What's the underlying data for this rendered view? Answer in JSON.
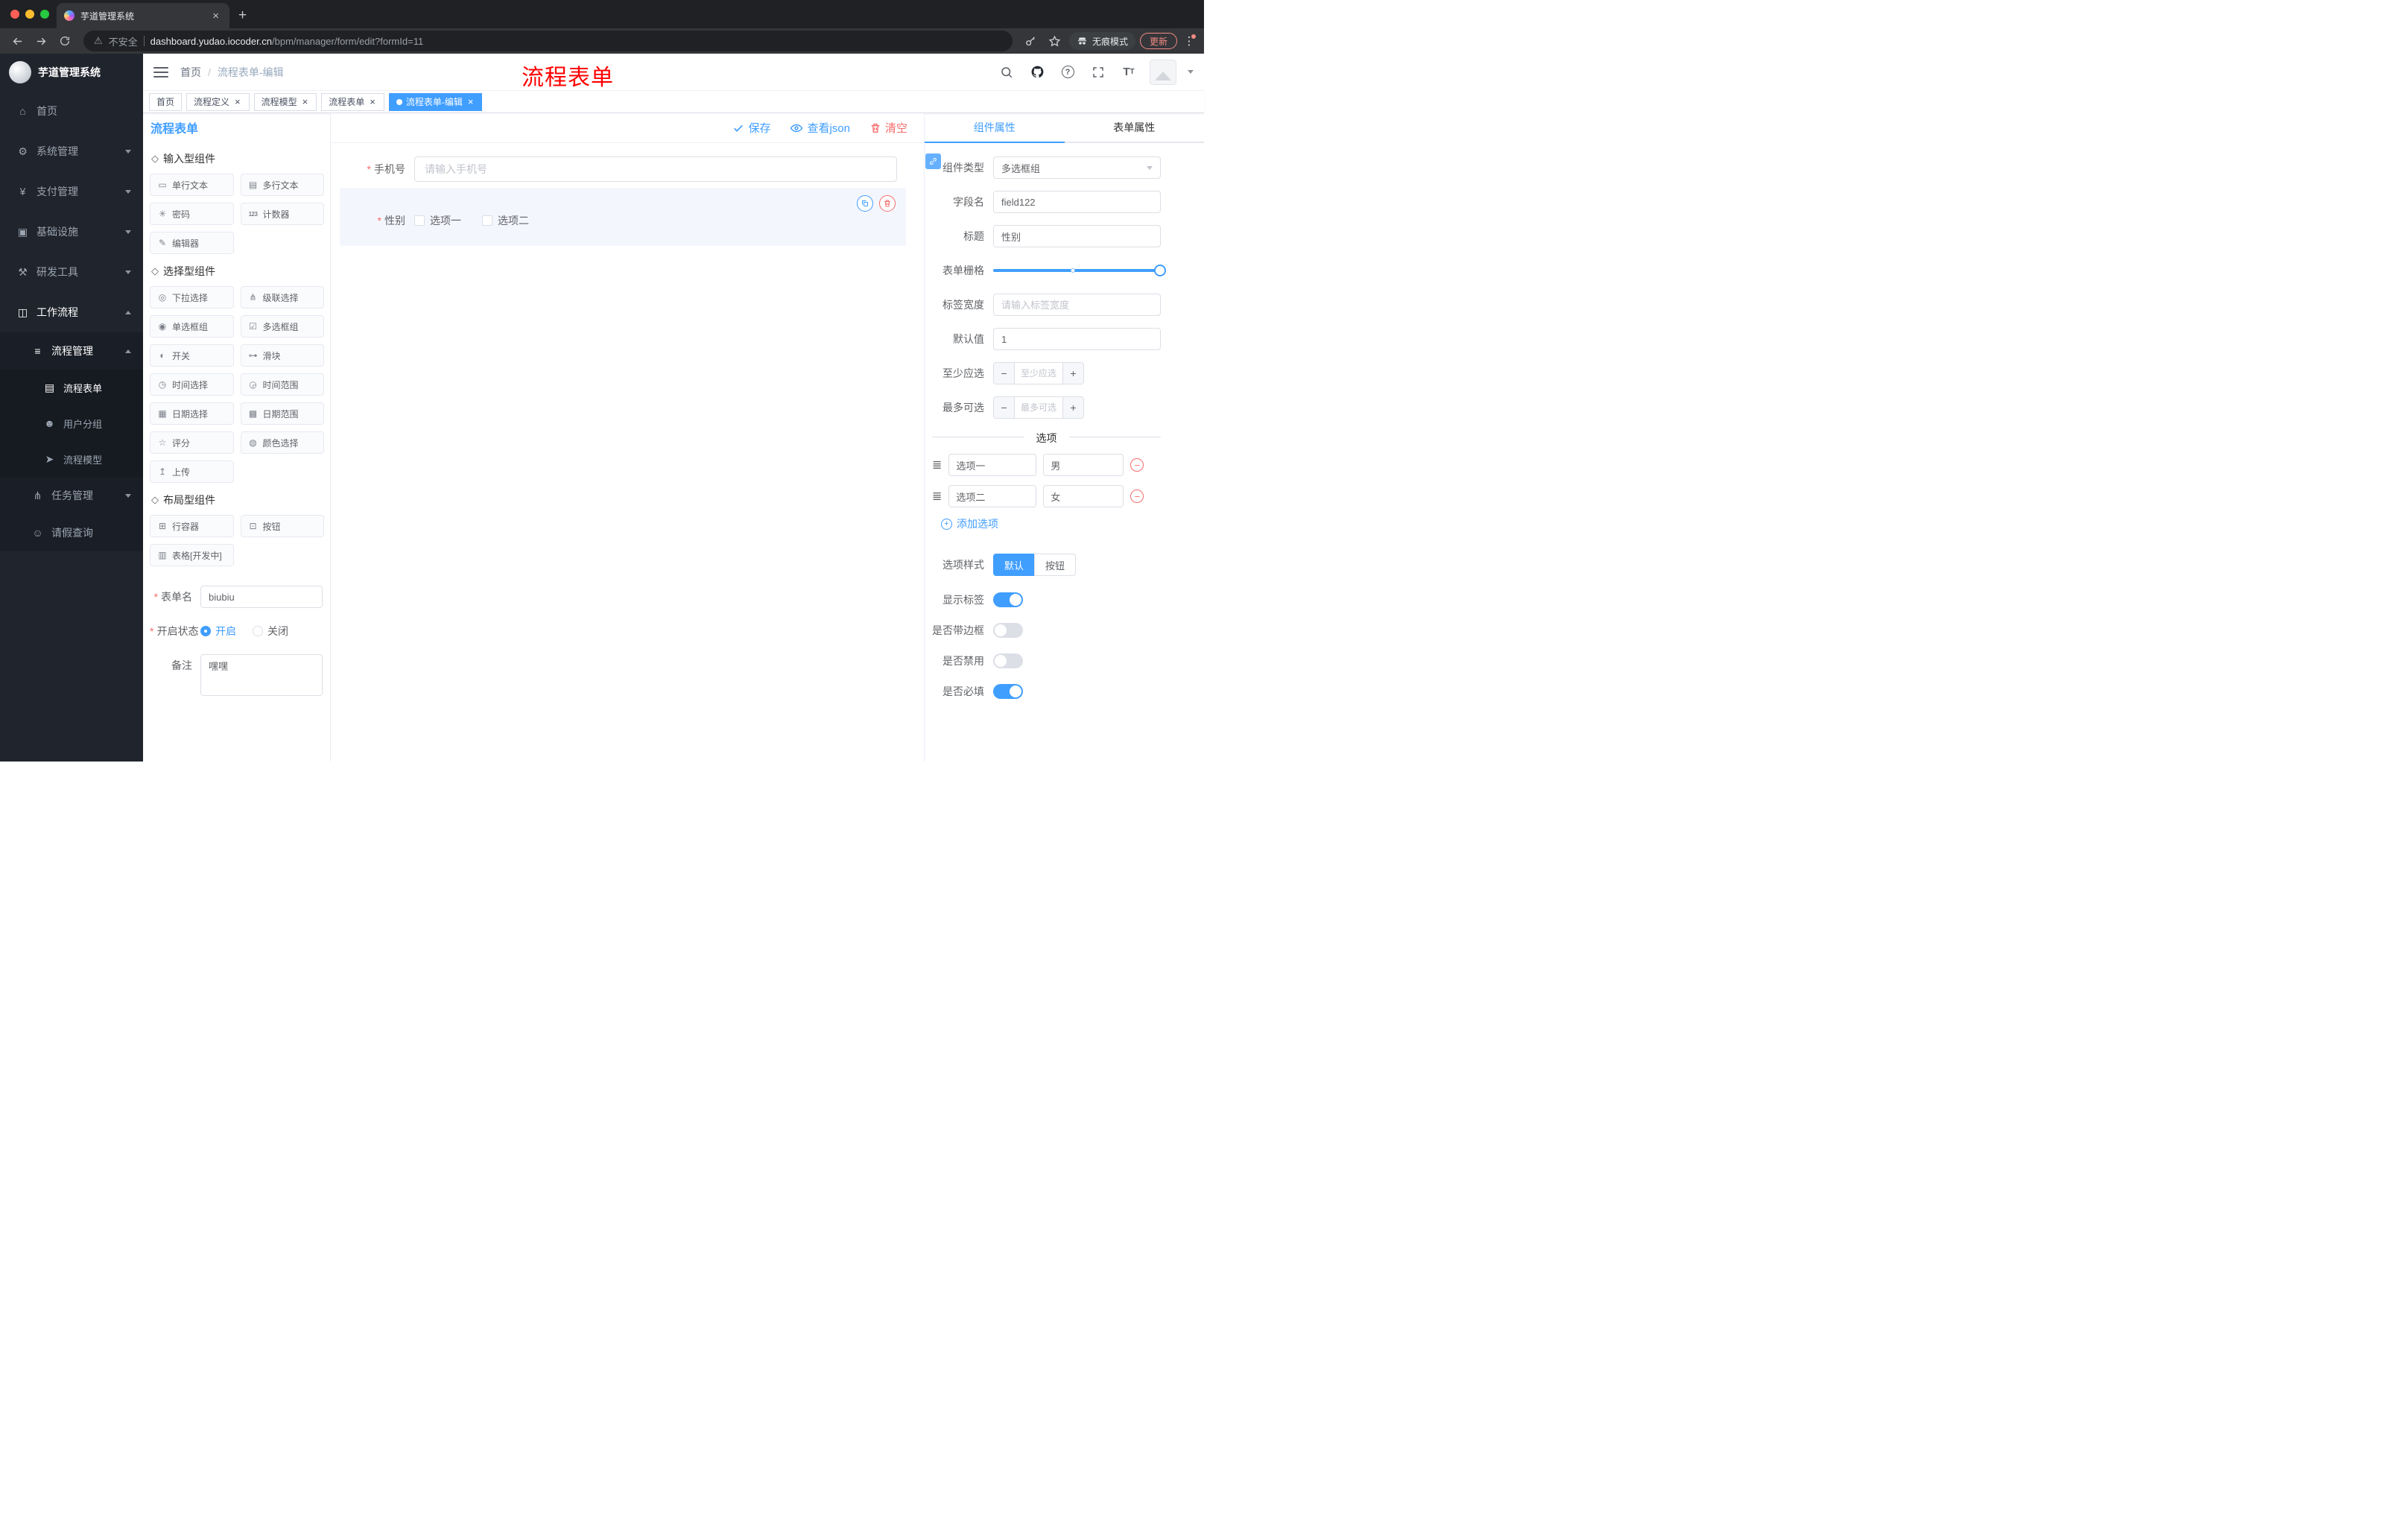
{
  "chrome": {
    "tab_title": "芋道管理系统",
    "security_label": "不安全",
    "url_host": "dashboard.yudao.iocoder.cn",
    "url_path": "/bpm/manager/form/edit?formId=11",
    "incognito_label": "无痕模式",
    "update_label": "更新"
  },
  "sidebar": {
    "logo_title": "芋道管理系统",
    "menu": [
      {
        "key": "home",
        "label": "首页",
        "icon": "dashboard-icon",
        "level": 1
      },
      {
        "key": "system",
        "label": "系统管理",
        "icon": "gear-icon",
        "level": 1,
        "chevron": "down"
      },
      {
        "key": "payment",
        "label": "支付管理",
        "icon": "payment-icon",
        "level": 1,
        "chevron": "down"
      },
      {
        "key": "infrastructure",
        "label": "基础设施",
        "icon": "infrastructure-icon",
        "level": 1,
        "chevron": "down"
      },
      {
        "key": "devtools",
        "label": "研发工具",
        "icon": "tools-icon",
        "level": 1,
        "chevron": "down"
      },
      {
        "key": "workflow",
        "label": "工作流程",
        "icon": "workflow-icon",
        "level": 1,
        "chevron": "up",
        "open": true
      },
      {
        "key": "process-management",
        "label": "流程管理",
        "icon": "process-icon",
        "level": 2,
        "chevron": "up",
        "open": true
      },
      {
        "key": "process-form",
        "label": "流程表单",
        "icon": "form-icon",
        "level": 3,
        "active": true
      },
      {
        "key": "user-group",
        "label": "用户分组",
        "icon": "user-group-icon",
        "level": 3
      },
      {
        "key": "process-model",
        "label": "流程模型",
        "icon": "model-icon",
        "level": 3
      },
      {
        "key": "task-management",
        "label": "任务管理",
        "icon": "task-icon",
        "level": 2,
        "chevron": "down"
      },
      {
        "key": "leave-query",
        "label": "请假查询",
        "icon": "leave-icon",
        "level": 2
      }
    ]
  },
  "navbar": {
    "breadcrumb_home": "首页",
    "breadcrumb_current": "流程表单-编辑",
    "watermark": "流程表单"
  },
  "tags": [
    {
      "key": "home",
      "label": "首页",
      "closable": false,
      "active": false
    },
    {
      "key": "process-definition",
      "label": "流程定义",
      "closable": true,
      "active": false
    },
    {
      "key": "process-model",
      "label": "流程模型",
      "closable": true,
      "active": false
    },
    {
      "key": "process-form",
      "label": "流程表单",
      "closable": true,
      "active": false
    },
    {
      "key": "process-form-edit",
      "label": "流程表单-编辑",
      "closable": true,
      "active": true
    }
  ],
  "palette": {
    "title": "流程表单",
    "sections": [
      {
        "title": "输入型组件",
        "items": [
          {
            "key": "input",
            "label": "单行文本",
            "icon": "input-icon"
          },
          {
            "key": "textarea",
            "label": "多行文本",
            "icon": "textarea-icon"
          },
          {
            "key": "password",
            "label": "密码",
            "icon": "lock-icon"
          },
          {
            "key": "counter",
            "label": "计数器",
            "icon": "counter-icon"
          },
          {
            "key": "editor",
            "label": "编辑器",
            "icon": "editor-icon"
          }
        ]
      },
      {
        "title": "选择型组件",
        "items": [
          {
            "key": "select",
            "label": "下拉选择",
            "icon": "select-icon"
          },
          {
            "key": "cascader",
            "label": "级联选择",
            "icon": "cascader-icon"
          },
          {
            "key": "radio-group",
            "label": "单选框组",
            "icon": "radio-icon"
          },
          {
            "key": "checkbox-group",
            "label": "多选框组",
            "icon": "checkbox-icon"
          },
          {
            "key": "switch",
            "label": "开关",
            "icon": "switch-icon"
          },
          {
            "key": "slider",
            "label": "滑块",
            "icon": "slider-icon"
          },
          {
            "key": "time-picker",
            "label": "时间选择",
            "icon": "time-icon"
          },
          {
            "key": "time-range",
            "label": "时间范围",
            "icon": "time-range-icon"
          },
          {
            "key": "date-picker",
            "label": "日期选择",
            "icon": "date-icon"
          },
          {
            "key": "date-range",
            "label": "日期范围",
            "icon": "date-range-icon"
          },
          {
            "key": "rate",
            "label": "评分",
            "icon": "rate-icon"
          },
          {
            "key": "color-picker",
            "label": "颜色选择",
            "icon": "color-icon"
          },
          {
            "key": "upload",
            "label": "上传",
            "icon": "upload-icon"
          }
        ]
      },
      {
        "title": "布局型组件",
        "items": [
          {
            "key": "row-container",
            "label": "行容器",
            "icon": "row-icon"
          },
          {
            "key": "button",
            "label": "按钮",
            "icon": "button-icon"
          },
          {
            "key": "table",
            "label": "表格[开发中]",
            "icon": "table-icon"
          }
        ]
      }
    ],
    "meta": {
      "form_name_label": "表单名",
      "form_name_value": "biubiu",
      "status_label": "开启状态",
      "status_on": "开启",
      "status_off": "关闭",
      "remark_label": "备注",
      "remark_value": "嘿嘿"
    }
  },
  "canvas": {
    "toolbar": {
      "save": "保存",
      "view_json": "查看json",
      "clear": "清空"
    },
    "phone_field": {
      "label": "手机号",
      "placeholder": "请输入手机号"
    },
    "gender_field": {
      "label": "性别",
      "option1": "选项一",
      "option2": "选项二"
    }
  },
  "props": {
    "tab_component": "组件属性",
    "tab_form": "表单属性",
    "component_type_label": "组件类型",
    "component_type_value": "多选框组",
    "field_name_label": "字段名",
    "field_name_value": "field122",
    "title_label": "标题",
    "title_value": "性别",
    "grid_label": "表单栅格",
    "label_width_label": "标签宽度",
    "label_width_placeholder": "请输入标签宽度",
    "default_label": "默认值",
    "default_value": "1",
    "min_label": "至少应选",
    "min_placeholder": "至少应选",
    "max_label": "最多可选",
    "max_placeholder": "最多可选",
    "options_divider": "选项",
    "options": [
      {
        "label": "选项一",
        "value": "男"
      },
      {
        "label": "选项二",
        "value": "女"
      }
    ],
    "add_option": "添加选项",
    "style_label": "选项样式",
    "style_default": "默认",
    "style_button": "按钮",
    "toggles": [
      {
        "key": "show-label",
        "label": "显示标签",
        "on": true
      },
      {
        "key": "with-border",
        "label": "是否带边框",
        "on": false
      },
      {
        "key": "disabled",
        "label": "是否禁用",
        "on": false
      },
      {
        "key": "required",
        "label": "是否必填",
        "on": true
      }
    ]
  },
  "colors": {
    "primary": "#409eff",
    "danger": "#f56c6c",
    "watermark": "#ff0000",
    "sidebar": "#20242c"
  }
}
